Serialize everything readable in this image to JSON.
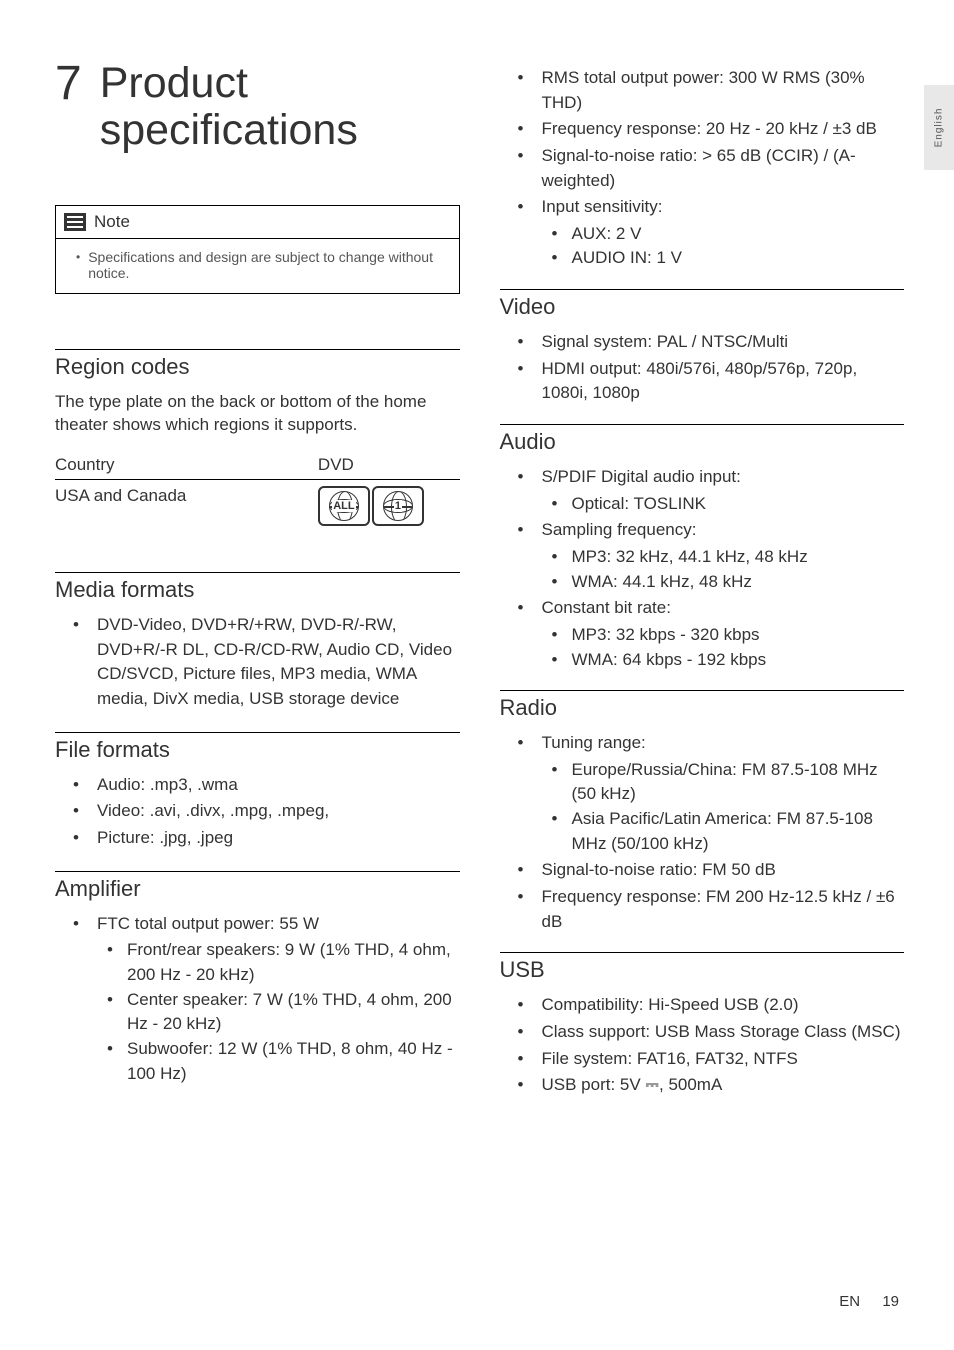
{
  "page_tab": "English",
  "chapter": {
    "number": "7",
    "title": "Product specifications"
  },
  "note": {
    "label": "Note",
    "text": "Specifications and design are subject to change without notice."
  },
  "region_codes": {
    "heading": "Region codes",
    "intro": "The type plate on the back or bottom of the home theater shows which regions it supports.",
    "col_country": "Country",
    "col_dvd": "DVD",
    "row_country": "USA and Canada",
    "icon1_text": "ALL",
    "icon2_text": "1"
  },
  "media_formats": {
    "heading": "Media formats",
    "item": "DVD-Video, DVD+R/+RW, DVD-R/-RW, DVD+R/-R DL, CD-R/CD-RW, Audio CD, Video CD/SVCD, Picture files, MP3 media, WMA media, DivX media, USB storage device"
  },
  "file_formats": {
    "heading": "File formats",
    "audio": "Audio: .mp3, .wma",
    "video": "Video: .avi, .divx, .mpg, .mpeg,",
    "picture": "Picture: .jpg, .jpeg"
  },
  "amplifier": {
    "heading": "Amplifier",
    "ftc": "FTC total output power: 55 W",
    "front_rear": "Front/rear speakers: 9 W (1% THD, 4 ohm, 200 Hz - 20 kHz)",
    "center": "Center speaker: 7 W (1% THD, 4 ohm, 200 Hz - 20 kHz)",
    "sub": "Subwoofer: 12 W (1% THD, 8 ohm, 40 Hz - 100 Hz)",
    "rms": "RMS total output power: 300 W RMS (30% THD)",
    "freq": "Frequency response: 20 Hz - 20 kHz / ±3 dB",
    "snr": "Signal-to-noise ratio: > 65 dB (CCIR) / (A-weighted)",
    "input": "Input sensitivity:",
    "aux": "AUX: 2 V",
    "audio_in": "AUDIO IN: 1 V"
  },
  "video": {
    "heading": "Video",
    "signal": "Signal system: PAL / NTSC/Multi",
    "hdmi": "HDMI output: 480i/576i, 480p/576p, 720p, 1080i, 1080p"
  },
  "audio": {
    "heading": "Audio",
    "spdif": "S/PDIF Digital audio input:",
    "optical": "Optical: TOSLINK",
    "sampling": "Sampling frequency:",
    "mp3_freq": "MP3: 32 kHz, 44.1 kHz, 48 kHz",
    "wma_freq": "WMA: 44.1 kHz, 48 kHz",
    "bitrate": "Constant bit rate:",
    "mp3_rate": "MP3: 32 kbps - 320 kbps",
    "wma_rate": "WMA: 64 kbps - 192 kbps"
  },
  "radio": {
    "heading": "Radio",
    "tuning": "Tuning range:",
    "europe": "Europe/Russia/China: FM 87.5-108 MHz (50 kHz)",
    "asia": "Asia Pacific/Latin America: FM 87.5-108 MHz (50/100 kHz)",
    "snr": "Signal-to-noise ratio: FM 50 dB",
    "freq": "Frequency response: FM 200 Hz-12.5 kHz / ±6 dB"
  },
  "usb": {
    "heading": "USB",
    "compat": "Compatibility: Hi-Speed USB (2.0)",
    "class": "Class support: USB Mass Storage Class (MSC)",
    "fs": "File system: FAT16, FAT32, NTFS",
    "port": "USB port: 5V ⎓, 500mA"
  },
  "footer": {
    "lang": "EN",
    "page": "19"
  }
}
